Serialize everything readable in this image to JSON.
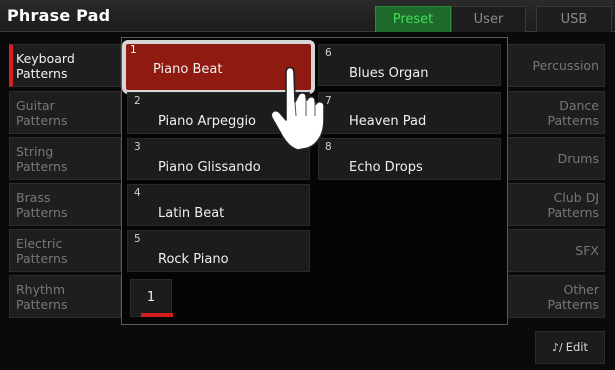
{
  "header": {
    "title": "Phrase Pad",
    "tabs": [
      {
        "label": "Preset",
        "active": true
      },
      {
        "label": "User",
        "active": false
      },
      {
        "label": "USB",
        "active": false
      }
    ]
  },
  "left_categories": [
    {
      "line1": "Keyboard",
      "line2": "Patterns",
      "active": true
    },
    {
      "line1": "Guitar",
      "line2": "Patterns",
      "active": false
    },
    {
      "line1": "String",
      "line2": "Patterns",
      "active": false
    },
    {
      "line1": "Brass",
      "line2": "Patterns",
      "active": false
    },
    {
      "line1": "Electric",
      "line2": "Patterns",
      "active": false
    },
    {
      "line1": "Rhythm",
      "line2": "Patterns",
      "active": false
    }
  ],
  "right_categories": [
    {
      "line1": "Percussion",
      "line2": ""
    },
    {
      "line1": "Dance",
      "line2": "Patterns"
    },
    {
      "line1": "Drums",
      "line2": ""
    },
    {
      "line1": "Club DJ",
      "line2": "Patterns"
    },
    {
      "line1": "SFX",
      "line2": ""
    },
    {
      "line1": "Other",
      "line2": "Patterns"
    }
  ],
  "phrases": [
    {
      "num": "1",
      "name": "Piano Beat",
      "selected": true
    },
    {
      "num": "2",
      "name": "Piano Arpeggio",
      "selected": false
    },
    {
      "num": "3",
      "name": "Piano Glissando",
      "selected": false
    },
    {
      "num": "4",
      "name": "Latin Beat",
      "selected": false
    },
    {
      "num": "5",
      "name": "Rock Piano",
      "selected": false
    },
    {
      "num": "6",
      "name": "Blues Organ",
      "selected": false
    },
    {
      "num": "7",
      "name": "Heaven Pad",
      "selected": false
    },
    {
      "num": "8",
      "name": "Echo Drops",
      "selected": false
    }
  ],
  "page": {
    "current": "1"
  },
  "edit_button": {
    "label": "Edit",
    "icon": "music-edit-icon"
  },
  "colors": {
    "accent_red": "#d21e1e",
    "selected_slot": "#8f1a12",
    "active_tab_text": "#3ee05a",
    "active_tab_bg": "#1d6a2a"
  }
}
